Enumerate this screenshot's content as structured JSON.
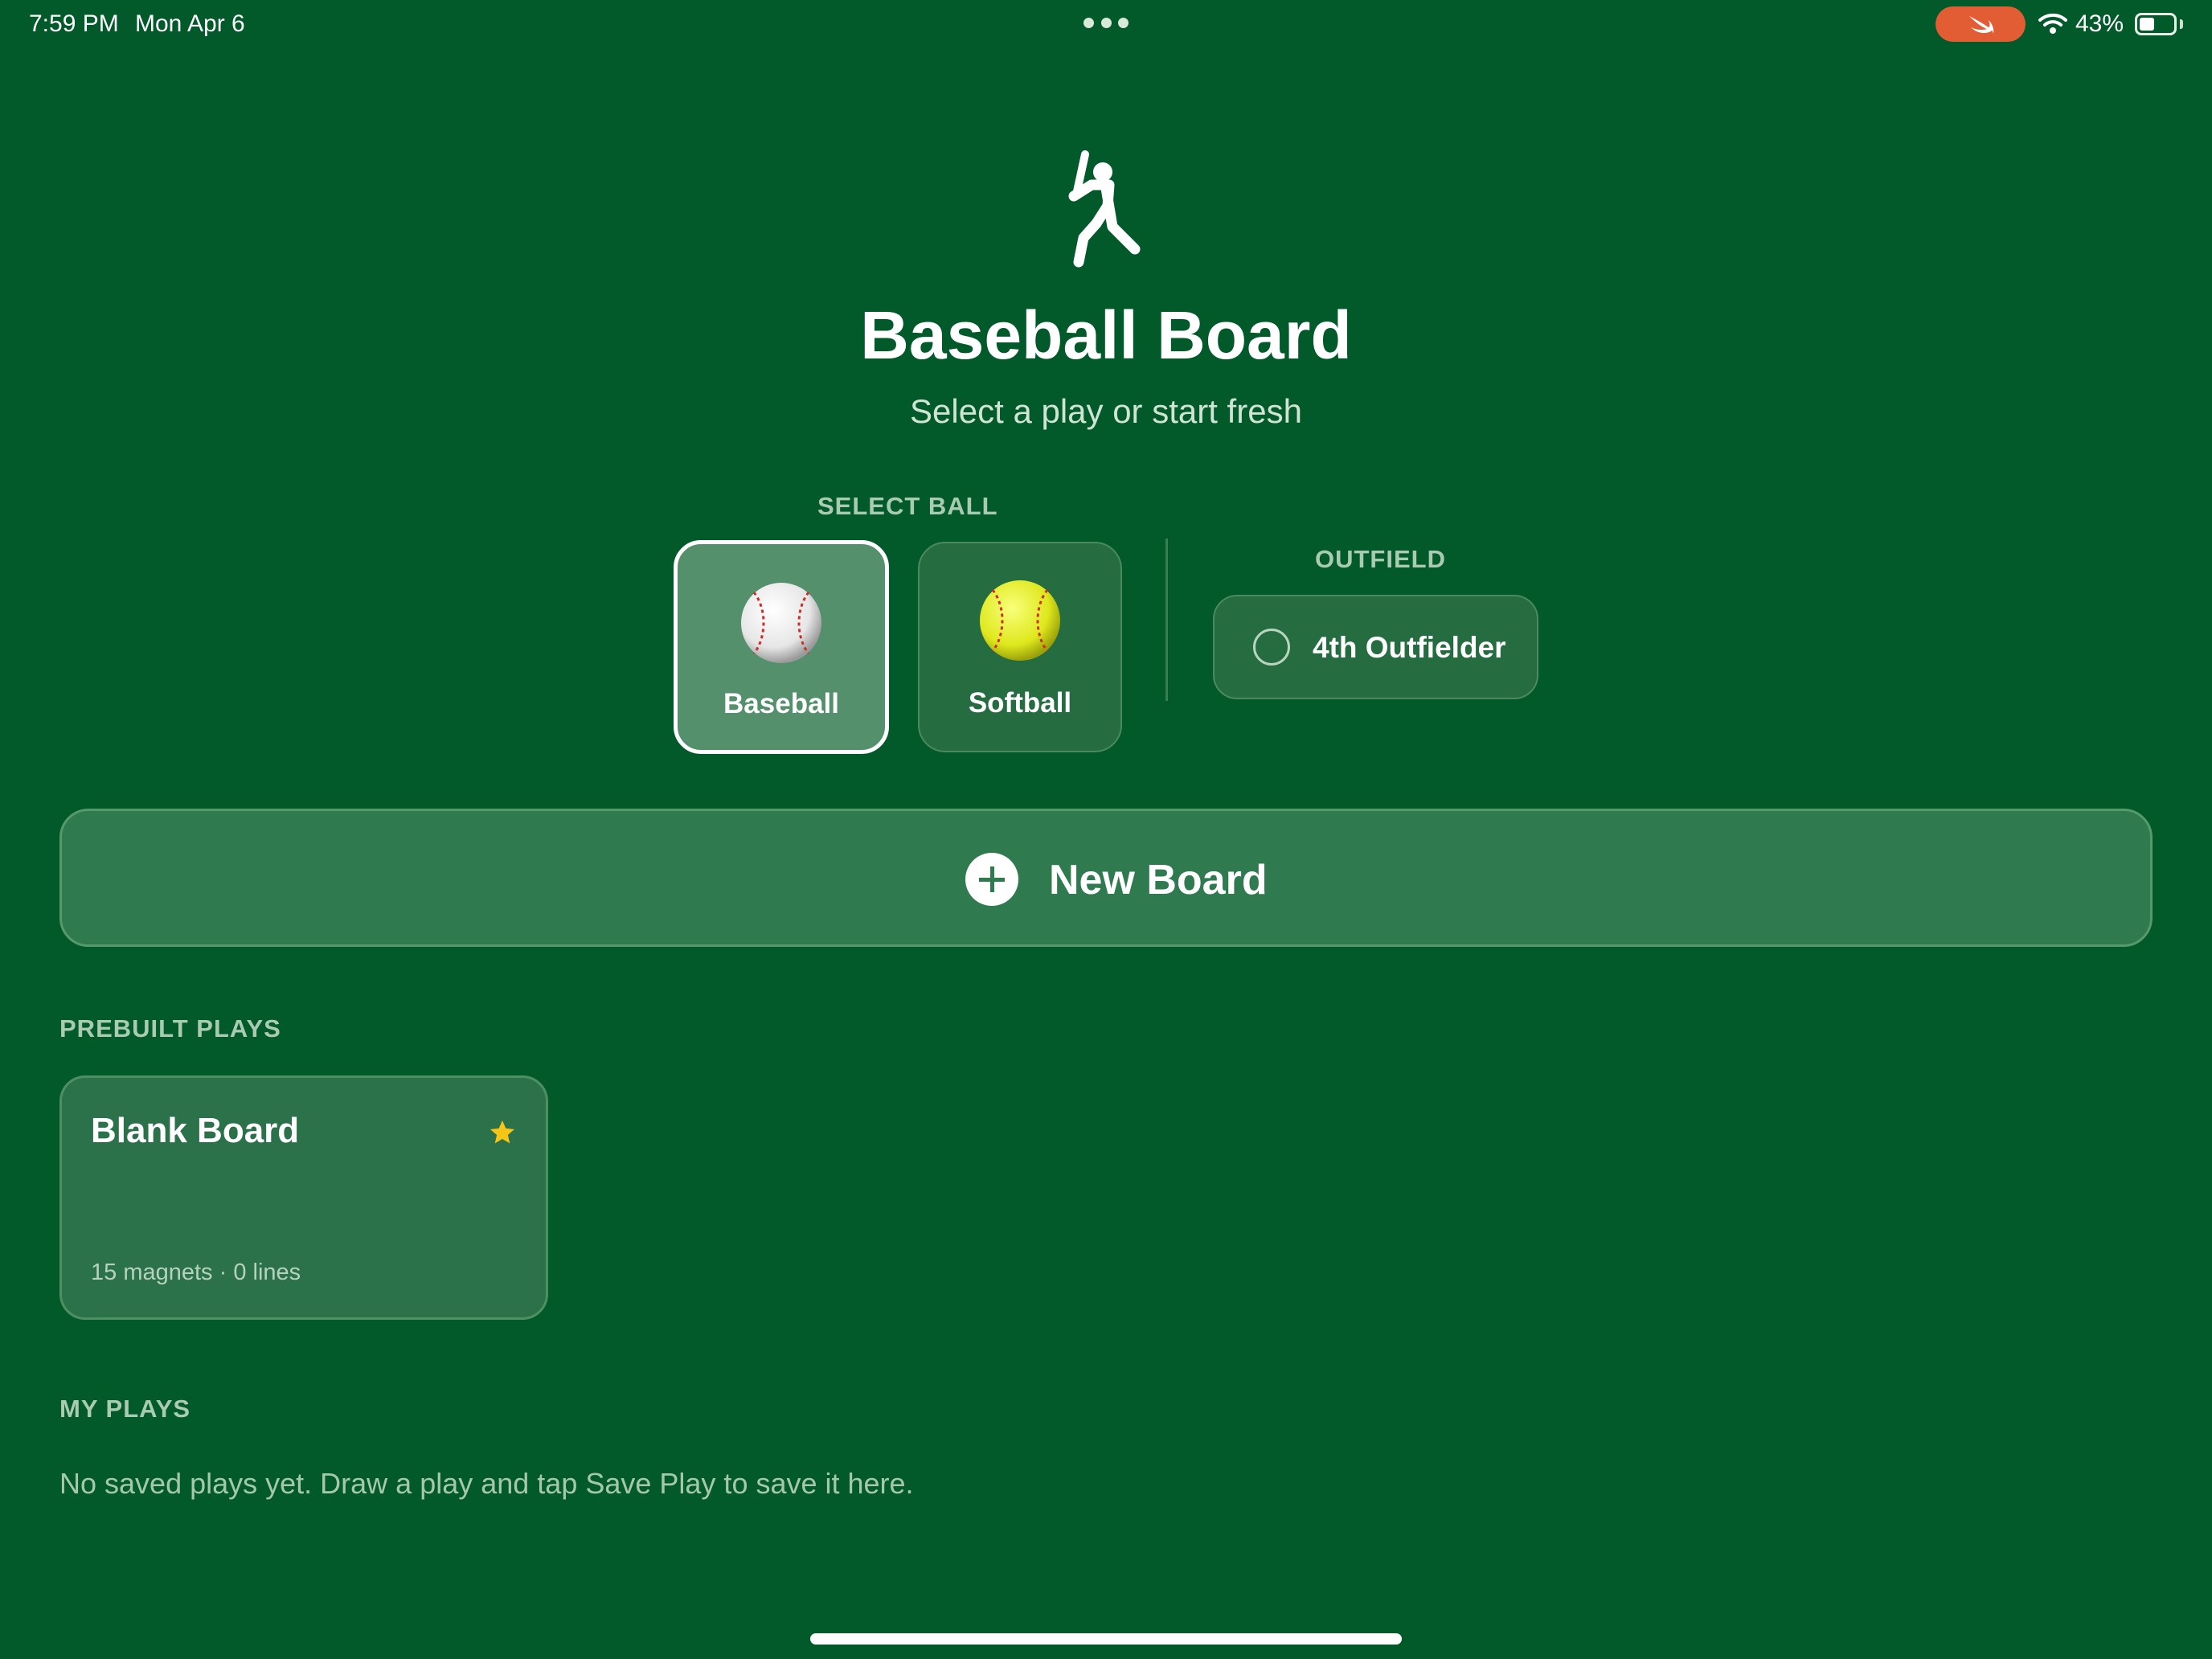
{
  "status_bar": {
    "time": "7:59 PM",
    "date": "Mon Apr 6",
    "battery": "43%",
    "battery_level": 0.43,
    "accent_pill_color": "#e25d33"
  },
  "header": {
    "icon": "baseball-batter-icon",
    "title": "Baseball Board",
    "subtitle": "Select a play or start fresh"
  },
  "ball_select": {
    "label": "SELECT BALL",
    "options": [
      {
        "label": "Baseball",
        "icon": "baseball-icon",
        "selected": true
      },
      {
        "label": "Softball",
        "icon": "softball-icon",
        "selected": false
      }
    ]
  },
  "outfield": {
    "label": "OUTFIELD",
    "toggle_label": "4th Outfielder",
    "checked": false
  },
  "new_board": {
    "label": "New Board",
    "icon": "plus-circle-icon"
  },
  "prebuilt": {
    "label": "PREBUILT PLAYS",
    "plays": [
      {
        "title": "Blank Board",
        "meta": "15 magnets · 0 lines",
        "favorite": true
      }
    ]
  },
  "my_plays": {
    "label": "MY PLAYS",
    "empty_text": "No saved plays yet. Draw a play and tap Save Play to save it here."
  },
  "colors": {
    "background": "#02592a",
    "card": "#256d40",
    "selected_card": "#53906b",
    "star": "#f5c518"
  }
}
